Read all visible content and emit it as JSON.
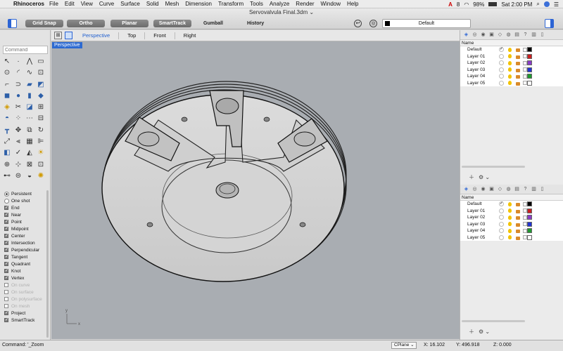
{
  "menubar": {
    "app_name": "Rhinoceros",
    "items": [
      "File",
      "Edit",
      "View",
      "Curve",
      "Surface",
      "Solid",
      "Mesh",
      "Dimension",
      "Transform",
      "Tools",
      "Analyze",
      "Render",
      "Window",
      "Help"
    ],
    "status": {
      "adobe_count": "8",
      "battery": "98%",
      "clock": "Sat 2:00 PM"
    }
  },
  "toolbar": {
    "document_title": "Servovalvula Final.3dm",
    "toggles": [
      "Grid Snap",
      "Ortho",
      "Planar",
      "SmartTrack"
    ],
    "gumball": "Gumball",
    "history": "History",
    "current_layer": "Default"
  },
  "left": {
    "command_placeholder": "Command",
    "osnap_modes": [
      {
        "label": "Persistent",
        "kind": "radio",
        "on": true,
        "dim": false
      },
      {
        "label": "One shot",
        "kind": "radio",
        "on": false,
        "dim": false
      },
      {
        "label": "End",
        "kind": "check",
        "on": true,
        "dim": false
      },
      {
        "label": "Near",
        "kind": "check",
        "on": true,
        "dim": false
      },
      {
        "label": "Point",
        "kind": "check",
        "on": true,
        "dim": false
      },
      {
        "label": "Midpoint",
        "kind": "check",
        "on": true,
        "dim": false
      },
      {
        "label": "Center",
        "kind": "check",
        "on": true,
        "dim": false
      },
      {
        "label": "Intersection",
        "kind": "check",
        "on": true,
        "dim": false
      },
      {
        "label": "Perpendicular",
        "kind": "check",
        "on": true,
        "dim": false
      },
      {
        "label": "Tangent",
        "kind": "check",
        "on": true,
        "dim": false
      },
      {
        "label": "Quadrant",
        "kind": "check",
        "on": true,
        "dim": false
      },
      {
        "label": "Knot",
        "kind": "check",
        "on": true,
        "dim": false
      },
      {
        "label": "Vertex",
        "kind": "check",
        "on": true,
        "dim": false
      },
      {
        "label": "On curve",
        "kind": "check",
        "on": false,
        "dim": true
      },
      {
        "label": "On surface",
        "kind": "check",
        "on": false,
        "dim": true
      },
      {
        "label": "On polysurface",
        "kind": "check",
        "on": false,
        "dim": true
      },
      {
        "label": "On mesh",
        "kind": "check",
        "on": false,
        "dim": true
      },
      {
        "label": "Project",
        "kind": "check",
        "on": true,
        "dim": false
      },
      {
        "label": "SmartTrack",
        "kind": "check",
        "on": true,
        "dim": false
      }
    ]
  },
  "viewport": {
    "tabs": [
      "Perspective",
      "Top",
      "Front",
      "Right"
    ],
    "active_tab": "Perspective",
    "label": "Perspective",
    "axis_x": "x",
    "axis_y": "y"
  },
  "layers": {
    "name_header": "Name",
    "rows": [
      {
        "name": "Default",
        "color": "#000000",
        "current": true
      },
      {
        "name": "Layer 01",
        "color": "#cc1f1f",
        "current": false
      },
      {
        "name": "Layer 02",
        "color": "#8a3cc8",
        "current": false
      },
      {
        "name": "Layer 03",
        "color": "#2233d4",
        "current": false
      },
      {
        "name": "Layer 04",
        "color": "#1f9a2e",
        "current": false
      },
      {
        "name": "Layer 05",
        "color": "#ffffff",
        "current": false
      }
    ]
  },
  "status": {
    "command": "Command: '_Zoom",
    "cplane": "CPlane",
    "x": "X: 16.102",
    "y": "Y: 496.918",
    "z": "Z: 0.000"
  }
}
